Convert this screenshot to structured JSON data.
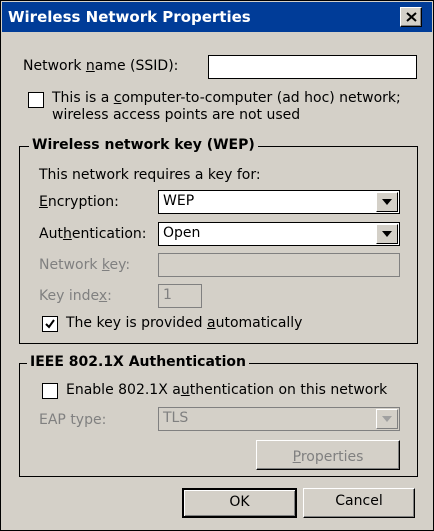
{
  "window": {
    "title": "Wireless Network Properties",
    "close_icon": "close-x-icon"
  },
  "ssid": {
    "label_pre": "Network ",
    "label_mnemonic": "n",
    "label_post": "ame (SSID):",
    "value": ""
  },
  "adhoc": {
    "checked": false,
    "line1_pre": "This is a ",
    "line1_mnemonic": "c",
    "line1_post": "omputer-to-computer (ad hoc) network;",
    "line2": "wireless access points are not used"
  },
  "wep_group": {
    "title": "Wireless network key (WEP)",
    "intro": "This network requires a key for:",
    "encryption": {
      "label_mnemonic": "E",
      "label_post": "ncryption:",
      "value": "WEP"
    },
    "authentication": {
      "label_pre": "Aut",
      "label_mnemonic": "h",
      "label_post": "entication:",
      "value": "Open"
    },
    "network_key": {
      "label_pre": "Network ",
      "label_mnemonic": "k",
      "label_post": "ey:",
      "value": ""
    },
    "key_index": {
      "label_pre": "Key inde",
      "label_mnemonic": "x",
      "label_post": ":",
      "value": "1"
    },
    "auto_key": {
      "checked": true,
      "label_pre": "The key is provided ",
      "label_mnemonic": "a",
      "label_post": "utomatically"
    }
  },
  "ieee_group": {
    "title": "IEEE 802.1X Authentication",
    "enable": {
      "checked": false,
      "label_pre": "Enable 802.1X a",
      "label_mnemonic": "u",
      "label_post": "thentication on this network"
    },
    "eap_type": {
      "label": "EAP type:",
      "value": "TLS"
    },
    "properties_button": {
      "label_mnemonic": "P",
      "label_post": "roperties"
    }
  },
  "buttons": {
    "ok": "OK",
    "cancel": "Cancel"
  },
  "colors": {
    "titlebar": "#003c98",
    "face": "#d4d0c8",
    "disabled_text": "#808080"
  }
}
